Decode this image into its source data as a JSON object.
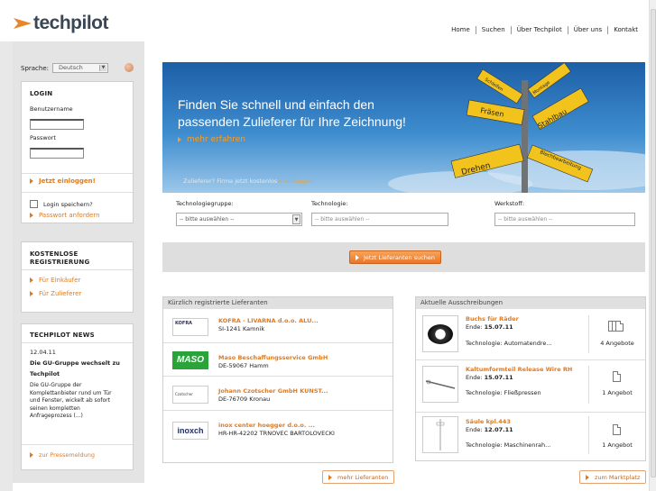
{
  "header": {
    "logo_text": "techpilot",
    "nav": [
      "Home",
      "Suchen",
      "Über Techpilot",
      "Über uns",
      "Kontakt"
    ]
  },
  "sidebar": {
    "language_label": "Sprache:",
    "language_value": "Deutsch",
    "login": {
      "title": "LOGIN",
      "username_label": "Benutzername",
      "password_label": "Passwort",
      "login_link": "Jetzt einloggen!",
      "remember_label": "Login speichern?",
      "request_password": "Passwort anfordern"
    },
    "registration": {
      "title_line1": "KOSTENLOSE",
      "title_line2": "REGISTRIERUNG",
      "buyers_link": "Für Einkäufer",
      "suppliers_link": "Für Zulieferer"
    },
    "news": {
      "title": "TECHPILOT NEWS",
      "date": "12.04.11",
      "headline_line1": "Die GU-Gruppe wechselt zu",
      "headline_line2": "Techpilot",
      "body_lines": [
        "Die GU-Gruppe der",
        "Komplettanbieter rund um Tür",
        "und Fenster, wickelt ab sofort",
        "seinen kompletten",
        "Anfrageprozess (...)"
      ],
      "press_link": "zur Pressemeldung"
    }
  },
  "banner": {
    "headline_line1": "Finden Sie schnell und einfach den",
    "headline_line2": "passenden Zulieferer für Ihre Zeichnung!",
    "more_link": "mehr erfahren",
    "footer_text": "Zulieferer? Firma jetzt kostenlos",
    "footer_link": "eintragen!",
    "signs": [
      "Fräsen",
      "Stahlbau",
      "Drehen",
      "Blechbearbeitung",
      "Schleifen",
      "Montage"
    ]
  },
  "filters": {
    "tech_group_label": "Technologiegruppe:",
    "tech_group_value": "-- bitte auswählen --",
    "technology_label": "Technologie:",
    "technology_placeholder": "-- bitte auswählen --",
    "material_label": "Werkstoff:",
    "material_placeholder": "-- bitte auswählen --",
    "search_button": "Jetzt Lieferanten suchen"
  },
  "suppliers": {
    "title": "Kürzlich registrierte Lieferanten",
    "items": [
      {
        "name": "KOFRA - LIVARNA d.o.o. ALU...",
        "address": "SI-1241 Kamnik",
        "logo": "KOFRA"
      },
      {
        "name": "Maso Beschaffungsservice GmbH",
        "address": "DE-59067 Hamm",
        "logo": "MASO"
      },
      {
        "name": "Johann Czotscher GmbH KUNST...",
        "address": "DE-76709 Kronau",
        "logo": "Czotscher"
      },
      {
        "name": "inox center hoegger d.o.o. ...",
        "address": "HR-HR-42202 TRNOVEC BARTOLOVECKI",
        "logo": "inoxch"
      }
    ],
    "more_button": "mehr Lieferanten"
  },
  "tenders": {
    "title": "Aktuelle Ausschreibungen",
    "end_label": "Ende:",
    "tech_label": "Technologie:",
    "items": [
      {
        "title": "Buchs für Räder",
        "end": "15.07.11",
        "tech": "Automatendre...",
        "offers": "4 Angebote"
      },
      {
        "title": "Kaltumformteil Release Wire RH",
        "end": "15.07.11",
        "tech": "Fließpressen",
        "offers": "1 Angebot"
      },
      {
        "title": "Säule kpl.443",
        "end": "12.07.11",
        "tech": "Maschinenrah...",
        "offers": "1 Angebot"
      }
    ],
    "market_button": "zum Marktplatz"
  },
  "colors": {
    "accent": "#e07a1f",
    "brand_dark": "#3a4654",
    "banner_blue": "#1d5fa7"
  }
}
